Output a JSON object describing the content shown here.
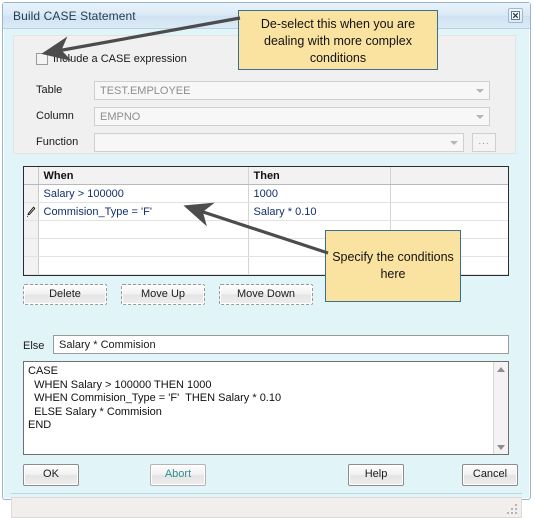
{
  "window": {
    "title": "Build CASE Statement",
    "close_icon": "close-icon"
  },
  "form": {
    "include_case_label": "Include a CASE expression",
    "include_case_checked": false,
    "fields": [
      {
        "label": "Table",
        "value": "TEST.EMPLOYEE",
        "has_browse": false
      },
      {
        "label": "Column",
        "value": "EMPNO",
        "has_browse": false
      },
      {
        "label": "Function",
        "value": "",
        "has_browse": true
      }
    ],
    "browse_button_label": "..."
  },
  "grid": {
    "columns": [
      "When",
      "Then",
      ""
    ],
    "rows": [
      {
        "marker": "",
        "when": "Salary > 100000",
        "then": "1000"
      },
      {
        "marker": "edit-pencil-icon",
        "when": "Commision_Type = 'F'",
        "then": "Salary * 0.10"
      },
      {
        "marker": "",
        "when": "",
        "then": ""
      },
      {
        "marker": "",
        "when": "",
        "then": ""
      },
      {
        "marker": "",
        "when": "",
        "then": ""
      }
    ]
  },
  "list_actions": {
    "delete_label": "Delete",
    "move_up_label": "Move Up",
    "move_down_label": "Move Down"
  },
  "else_row": {
    "label": "Else",
    "value": "Salary * Commision"
  },
  "sql_preview": {
    "text": "CASE\n  WHEN Salary > 100000 THEN 1000\n  WHEN Commision_Type = 'F'  THEN Salary * 0.10\n  ELSE Salary * Commision\nEND"
  },
  "footer": {
    "ok_label": "OK",
    "abort_label": "Abort",
    "help_label": "Help",
    "cancel_label": "Cancel"
  },
  "annotations": [
    {
      "id": "callout-1",
      "text": "De-select this when you are dealing with more complex conditions"
    },
    {
      "id": "callout-2",
      "text": "Specify the conditions here"
    }
  ],
  "colors": {
    "dialog_background": "#e1f4f8",
    "panel_background": "#f0f0f0",
    "callout_fill": "#fae3a0",
    "callout_border": "#3a6f92",
    "grid_text": "#12306b",
    "abort_text": "#2a8f92",
    "arrow": "#4c4c4c"
  }
}
